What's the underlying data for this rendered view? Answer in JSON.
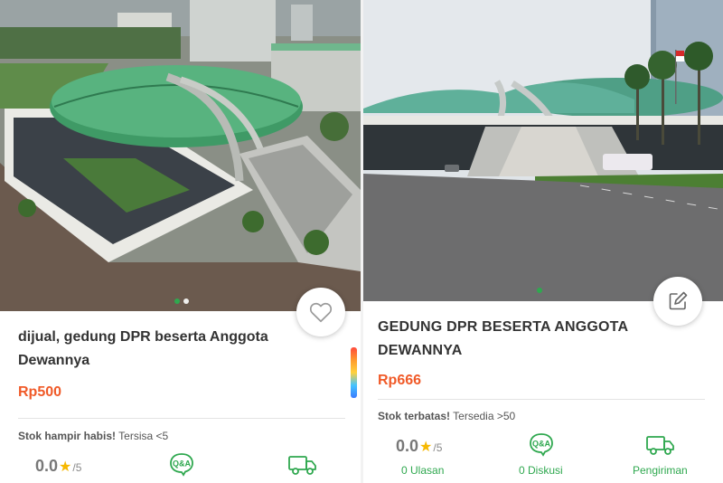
{
  "left": {
    "title": "dijual, gedung DPR beserta Anggota Dewannya",
    "price": "Rp500",
    "stock_warning": "Stok hampir habis!",
    "stock_detail": "Tersisa <5",
    "rating_value": "0.0",
    "rating_max": "/5",
    "carousel_dots": 2,
    "carousel_active": 1,
    "icons": {
      "fab": "heart-icon",
      "qa": "qa-icon",
      "shipping": "truck-icon"
    }
  },
  "right": {
    "title": "GEDUNG DPR BESERTA ANGGOTA DEWANNYA",
    "price": "Rp666",
    "stock_warning": "Stok terbatas!",
    "stock_detail": "Tersedia >50",
    "rating_value": "0.0",
    "rating_max": "/5",
    "reviews_label": "0 Ulasan",
    "discussion_label": "0 Diskusi",
    "shipping_label": "Pengiriman",
    "carousel_dots": 1,
    "carousel_active": 1,
    "icons": {
      "fab": "edit-icon",
      "qa": "qa-icon",
      "shipping": "truck-icon"
    }
  },
  "colors": {
    "price": "#f05a28",
    "accent_green": "#2fa84f",
    "star": "#f6b800"
  }
}
